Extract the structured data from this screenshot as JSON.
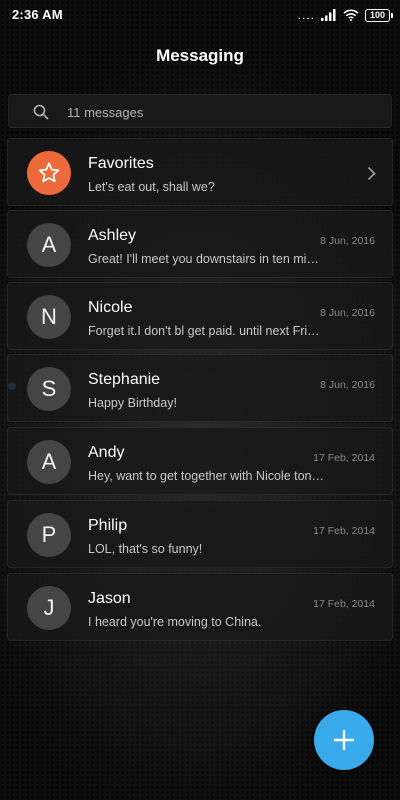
{
  "status_bar": {
    "time": "2:36 AM",
    "dots": "....",
    "battery": "100"
  },
  "header": {
    "title": "Messaging"
  },
  "search": {
    "label": "11 messages",
    "icon": "search-icon"
  },
  "conversations": [
    {
      "type": "favorites",
      "name": "Favorites",
      "preview": "Let's eat out, shall we?",
      "date": "",
      "icon": "star-icon",
      "avatar_color": "#ee6a3a"
    },
    {
      "type": "contact",
      "initial": "A",
      "name": "Ashley",
      "preview": "Great! I'll meet you downstairs in ten minutes.",
      "date": "8 Jun, 2016",
      "unread": false
    },
    {
      "type": "contact",
      "initial": "N",
      "name": "Nicole",
      "preview": "Forget it.I don't bl get paid. until next Friday",
      "date": "8 Jun, 2016",
      "unread": false
    },
    {
      "type": "contact",
      "initial": "S",
      "name": "Stephanie",
      "preview": "Happy Birthday!",
      "date": "8 Jun, 2016",
      "unread": true
    },
    {
      "type": "contact",
      "initial": "A",
      "name": "Andy",
      "preview": "Hey, want to get together with Nicole tonight?",
      "date": "17 Feb, 2014",
      "unread": false
    },
    {
      "type": "contact",
      "initial": "P",
      "name": "Philip",
      "preview": "LOL, that's so funny!",
      "date": "17 Feb, 2014",
      "unread": false
    },
    {
      "type": "contact",
      "initial": "J",
      "name": "Jason",
      "preview": "I heard you're moving to China.",
      "date": "17 Feb, 2014",
      "unread": false
    }
  ],
  "fab": {
    "icon": "plus-icon",
    "color": "#38a9ea"
  },
  "colors": {
    "accent": "#38a9ea",
    "unread_dot": "#2f9be8",
    "favorites": "#ee6a3a"
  }
}
